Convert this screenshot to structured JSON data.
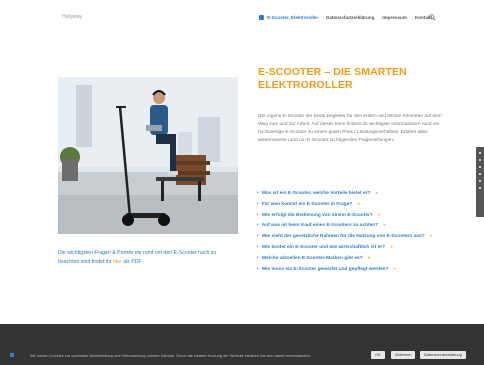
{
  "header": {
    "logo": "Hollyway",
    "nav": [
      {
        "label": "E-Scooter, Elektroroller",
        "active": true
      },
      {
        "label": "Datenschutzerklärung"
      },
      {
        "label": "Impressum"
      },
      {
        "label": "Kontakt"
      }
    ],
    "search_icon": "search-icon"
  },
  "hero_image": {
    "description_icon": "photo"
  },
  "caption": {
    "text_before": "Die wichtigsten Fragen & Punkte die rund um den E-Scooter nach zu beachten sind findet ihr",
    "link": "hier",
    "text_after": "als PDF"
  },
  "main": {
    "title": "E-SCOOTER – DIE SMARTEN ELEKTROROLLER",
    "intro": "Der eigene E-Scooter der beste Begleiter für den ersten und letzten Kilometer auf dem Weg zum und zur Arbeit. Auf dieser Seite findest du wichtigste Informationen rund um hochwertige E-Scooter zu einem guten Preis / Leistungsverhältnis. Erfahre alles wissenswerte rund um E-Scooter zu folgenden Fragestellungen:",
    "faq": [
      "Was ist ein E-Scooter, welche Vorteile bietet er?",
      "Für wen kommt ein E-Scooter in Frage?",
      "Wie erfolgt die Bedienung von einem E-Scooter?",
      "Auf was ist beim Kauf eines E-Scooters zu achten?",
      "Wie sieht der gesetzliche Rahmen für die Nutzung von E-Scootern aus?",
      "Wie kostet ein E-Scooter und wie wirtschaftlich ist er?",
      "Welche aktuellen E-Scooter-Marken gibt es?",
      "Wie muss ein E-Scooter gewartet und gepflegt werden?"
    ],
    "faq_arrow": "»"
  },
  "cookie": {
    "text": "Wir nutzen Cookies zur optimalen Bereitstellung und Verbesserung unserer Dienste. Durch die weitere Nutzung der Website erklären Sie sich damit einverstanden.",
    "ok": "OK",
    "decline": "Ablehnen",
    "privacy": "Datenschutzerklärung"
  },
  "colors": {
    "accent_blue": "#2a7fd4",
    "accent_orange": "#f39c12",
    "cookie_bg": "#333333"
  }
}
